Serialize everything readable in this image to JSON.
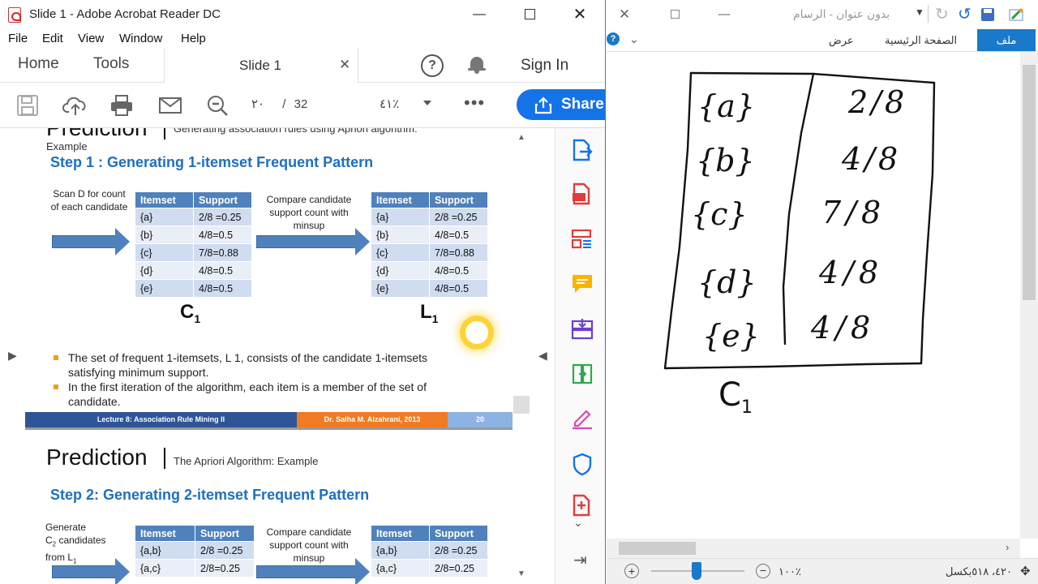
{
  "acrobat": {
    "window_title": "Slide 1 - Adobe Acrobat Reader DC",
    "menu": [
      "File",
      "Edit",
      "View",
      "Window",
      "Help"
    ],
    "tabs": {
      "home": "Home",
      "tools": "Tools",
      "document": "Slide 1"
    },
    "sign_in": "Sign In",
    "toolbar": {
      "page_current": "٢٠",
      "page_sep": "/",
      "page_total": "32",
      "zoom": "٤١٪",
      "share": "Share"
    },
    "slide1": {
      "heading": "Prediction",
      "subheading": "Generating association rules using Apriori algorithm:",
      "subheading2": "Example",
      "step": "Step 1 : Generating 1-itemset Frequent Pattern",
      "caption_scan": "Scan D for count of each candidate",
      "caption_compare": "Compare candidate support count with minsup",
      "headers": [
        "Itemset",
        "Support"
      ],
      "c1_rows": [
        [
          "{a}",
          "2/8 =0.25"
        ],
        [
          "{b}",
          "4/8=0.5"
        ],
        [
          "{c}",
          "7/8=0.88"
        ],
        [
          "{d}",
          "4/8=0.5"
        ],
        [
          "{e}",
          "4/8=0.5"
        ]
      ],
      "l1_rows": [
        [
          "{a}",
          "2/8 =0.25"
        ],
        [
          "{b}",
          "4/8=0.5"
        ],
        [
          "{c}",
          "7/8=0.88"
        ],
        [
          "{d}",
          "4/8=0.5"
        ],
        [
          "{e}",
          "4/8=0.5"
        ]
      ],
      "c1_label": "C",
      "c1_sub": "1",
      "l1_label": "L",
      "l1_sub": "1",
      "bullets": [
        "The set of frequent 1-itemsets, L 1, consists of the candidate 1-itemsets satisfying minimum support.",
        "In the first iteration of the algorithm, each item is a member of the set of candidate."
      ],
      "footer_left": "Lecture 8:  Association Rule Mining II",
      "footer_mid": "Dr. Salha M. Alzahrani, 2013",
      "footer_right": "20"
    },
    "slide2": {
      "heading": "Prediction",
      "subheading": "The Apriori Algorithm: Example",
      "step": "Step 2: Generating 2-itemset Frequent Pattern",
      "caption_gen_1": "Generate",
      "caption_gen_2": "C",
      "caption_gen_2_sub": "2",
      "caption_gen_3": " candidates",
      "caption_gen_4": "from L",
      "caption_gen_4_sub": "1",
      "caption_compare": "Compare candidate support count with minsup",
      "headers": [
        "Itemset",
        "Support"
      ],
      "c2_rows": [
        [
          "{a,b}",
          "2/8 =0.25"
        ],
        [
          "{a,c}",
          "2/8=0.25"
        ]
      ],
      "l2_rows": [
        [
          "{a,b}",
          "2/8 =0.25"
        ],
        [
          "{a,c}",
          "2/8=0.25"
        ]
      ]
    }
  },
  "paint": {
    "window_title": "بدون عنوان - الرسام",
    "ribbon_tabs": {
      "file": "ملف",
      "home": "الصفحة الرئيسية",
      "view": "عرض"
    },
    "zoom": "١٠٠٪",
    "coords": "٤٢٠، ٥١٨بكسل",
    "drawing": {
      "items": [
        "{a}",
        "{b}",
        "{c}",
        "{d}",
        "{e}"
      ],
      "supports": [
        "2/8",
        "4/8",
        "7/8",
        "4/8",
        "4/8"
      ],
      "label": "C",
      "label_sub": "1"
    }
  },
  "colors": {
    "acrobat_blue": "#1473e6",
    "table_header": "#4f81bd",
    "step_blue": "#1f6fbf",
    "footer_blue": "#2e5597",
    "footer_orange": "#f07b22",
    "footer_lightblue": "#8db3e2",
    "paint_file_tab": "#1979ca"
  }
}
